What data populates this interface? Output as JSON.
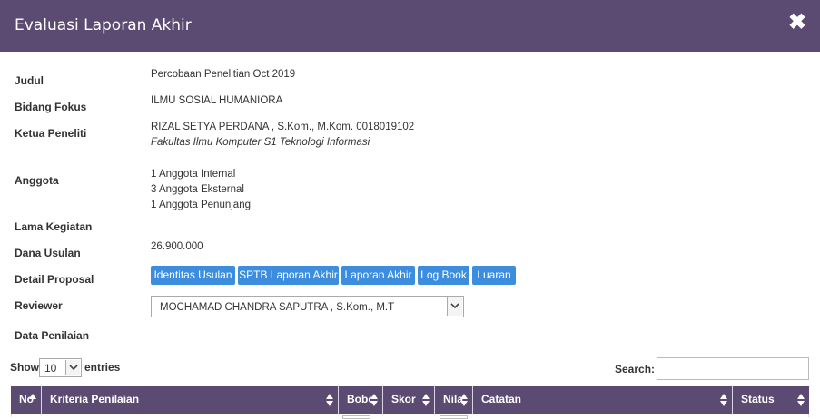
{
  "modal": {
    "title": "Evaluasi Laporan Akhir",
    "close_symbol": "✖"
  },
  "fields": {
    "judul": {
      "label": "Judul",
      "value": "Percobaan Penelitian Oct 2019"
    },
    "bidang_fokus": {
      "label": "Bidang Fokus",
      "value": "ILMU SOSIAL HUMANIORA"
    },
    "ketua_peneliti": {
      "label": "Ketua Peneliti",
      "name": "RIZAL SETYA PERDANA , S.Kom., M.Kom. 0018019102",
      "faculty": "Fakultas Ilmu Komputer S1 Teknologi Informasi"
    },
    "anggota": {
      "label": "Anggota",
      "lines": [
        "1 Anggota Internal",
        "3 Anggota Eksternal",
        "1 Anggota Penunjang"
      ]
    },
    "lama_kegiatan": {
      "label": "Lama Kegiatan",
      "value": ""
    },
    "dana_usulan": {
      "label": "Dana Usulan",
      "value": "26.900.000"
    },
    "detail_proposal": {
      "label": "Detail Proposal",
      "buttons": [
        "Identitas Usulan",
        "SPTB Laporan Akhir",
        "Laporan Akhir",
        "Log Book",
        "Luaran"
      ]
    },
    "reviewer": {
      "label": "Reviewer",
      "selected": "MOCHAMAD CHANDRA SAPUTRA , S.Kom., M.T"
    },
    "data_penilaian": {
      "label": "Data Penilaian"
    }
  },
  "table_controls": {
    "show_label": "Show",
    "entries_value": "10",
    "entries_label": "entries",
    "search_label": "Search:",
    "search_value": ""
  },
  "table": {
    "columns": [
      "No",
      "Kriteria Penilaian",
      "Bobot",
      "Skor",
      "Nilai",
      "Catatan",
      "Status"
    ]
  },
  "colors": {
    "header_bg": "#5b4a72",
    "button_bg": "#3c8dde"
  }
}
